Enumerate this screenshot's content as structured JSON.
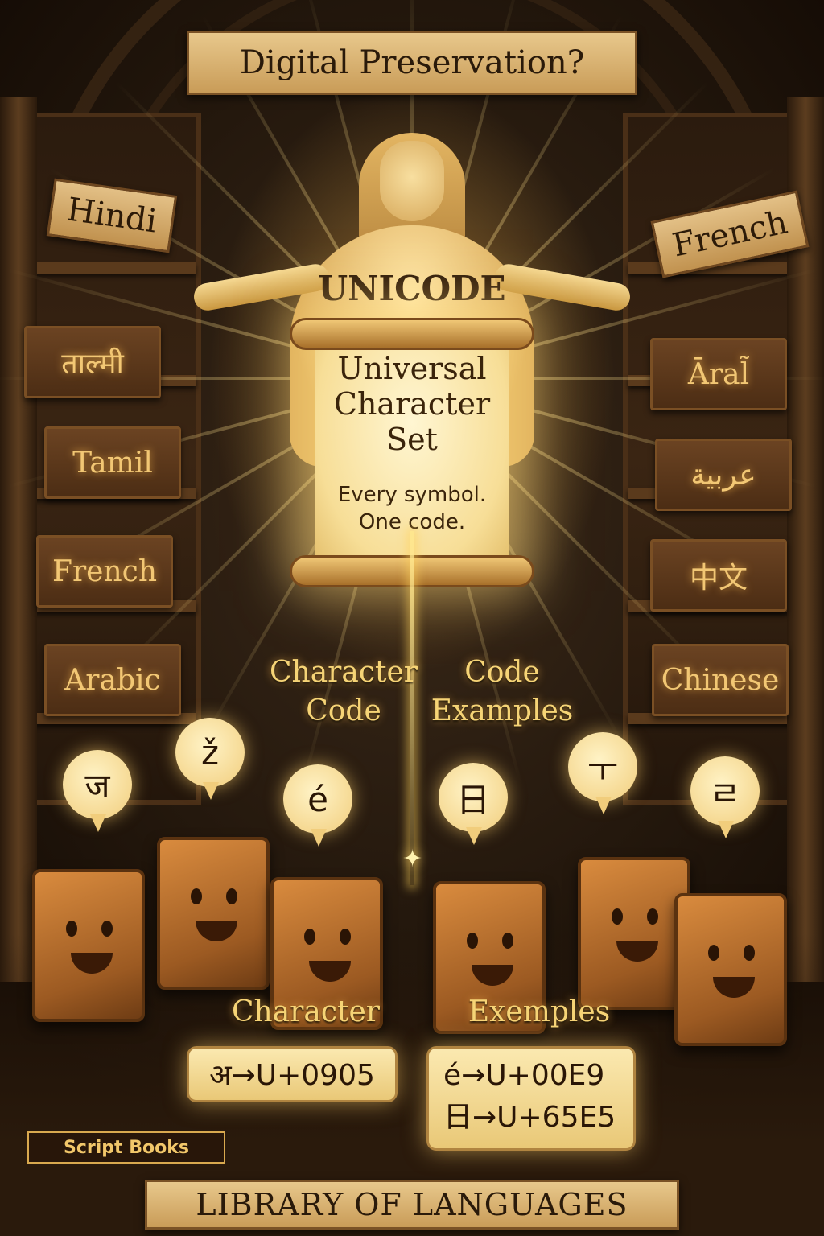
{
  "header": {
    "title": "Digital Preservation?"
  },
  "center": {
    "figure_title": "UNICODE",
    "scroll_title": "Universal\nCharacter\nSet",
    "scroll_tagline": "Every symbol.\nOne code."
  },
  "left_shelf": {
    "label": "Hindi",
    "books": [
      "ताल्मी",
      "Tamil",
      "French",
      "Arabic"
    ]
  },
  "right_shelf": {
    "label": "French",
    "books": [
      "Āral̃",
      "عربية",
      "中文",
      "Chinese"
    ]
  },
  "mid_headings": {
    "left": "Character\nCode",
    "right": "Code\nExamples"
  },
  "bubbles": [
    "ज",
    "ž",
    "é",
    "日",
    "ㅜ",
    "ㄹ"
  ],
  "lower_headings": {
    "character": "Character",
    "examples": "Exemples"
  },
  "code_examples": {
    "left": "अ→U+0905",
    "right": "é→U+00E9\n日→U+65E5"
  },
  "badge": "Script Books",
  "footer": {
    "title": "LIBRARY OF LANGUAGES"
  },
  "colors": {
    "glow": "#f6d476",
    "parchment": "#f7de97",
    "wood": "#4c2d14"
  }
}
